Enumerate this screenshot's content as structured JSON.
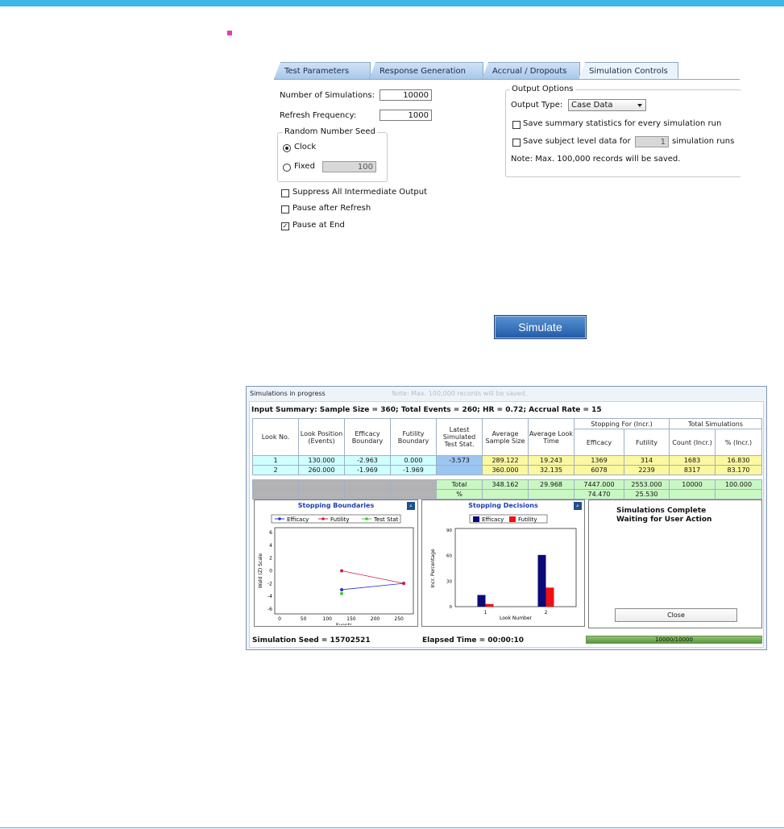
{
  "tabs": [
    "Test Parameters",
    "Response Generation",
    "Accrual / Dropouts",
    "Simulation Controls"
  ],
  "sim_controls": {
    "num_sims_label": "Number of Simulations:",
    "num_sims_value": "10000",
    "refresh_label": "Refresh Frequency:",
    "refresh_value": "1000",
    "seed_group": "Random Number Seed",
    "clock_label": "Clock",
    "fixed_label": "Fixed",
    "fixed_value": "100",
    "suppress_label": "Suppress All Intermediate Output",
    "pause_refresh_label": "Pause after Refresh",
    "pause_end_label": "Pause at End",
    "pause_end_check": "✓"
  },
  "output_options": {
    "group": "Output Options",
    "type_label": "Output Type:",
    "type_value": "Case Data",
    "save_summary": "Save summary statistics for every simulation run",
    "save_subject": "Save subject level data for",
    "subject_value": "1",
    "sim_runs": "simulation runs",
    "note": "Note: Max. 100,000 records will be saved."
  },
  "simulate_button": "Simulate",
  "window": {
    "title": "Simulations in progress",
    "ghost": "Note: Max. 100,000 records will be saved.",
    "summary": "Input Summary: Sample Size = 360; Total Events = 260; HR = 0.72; Accrual Rate = 15",
    "headers": {
      "look_no": "Look No.",
      "look_pos": "Look Position (Events)",
      "eff_bound": "Efficacy Boundary",
      "fut_bound": "Futility Boundary",
      "latest": "Latest Simulated Test Stat.",
      "avg_ss": "Average Sample Size",
      "avg_look": "Average Look Time",
      "stopping": "Stopping For (Incr.)",
      "efficacy": "Efficacy",
      "futility": "Futility",
      "total_sims": "Total Simulations",
      "count": "Count (Incr.)",
      "pct": "% (Incr.)"
    },
    "rows": [
      {
        "look": "1",
        "pos": "130.000",
        "eff": "-2.963",
        "fut": "0.000",
        "latest": "-3.573",
        "ss": "289.122",
        "time": "19.243",
        "s_eff": "1369",
        "s_fut": "314",
        "count": "1683",
        "pct": "16.830"
      },
      {
        "look": "2",
        "pos": "260.000",
        "eff": "-1.969",
        "fut": "-1.969",
        "latest": "",
        "ss": "360.000",
        "time": "32.135",
        "s_eff": "6078",
        "s_fut": "2239",
        "count": "8317",
        "pct": "83.170"
      }
    ],
    "total_row": {
      "label": "Total",
      "ss": "348.162",
      "time": "29.968",
      "s_eff": "7447.000",
      "s_fut": "2553.000",
      "count": "10000",
      "pct": "100.000"
    },
    "pct_row": {
      "label": "%",
      "s_eff": "74.470",
      "s_fut": "25.530"
    },
    "status_line1": "Simulations Complete",
    "status_line2": "Waiting for User Action",
    "close_label": "Close",
    "seed_text": "Simulation Seed = 15702521",
    "elapsed_text": "Elapsed Time = 00:00:10",
    "progress_text": "10000/10000",
    "progress_fraction": 1.0
  },
  "chart_data": [
    {
      "type": "line",
      "title": "Stopping Boundaries",
      "xlabel": "Events",
      "ylabel": "Wald (Z) Scale",
      "xlim": [
        0,
        270
      ],
      "ylim": [
        -6,
        6
      ],
      "xticks": [
        0,
        50,
        100,
        150,
        200,
        250
      ],
      "yticks": [
        6,
        4,
        2,
        0,
        -2,
        -4,
        -6
      ],
      "legend_position": "top",
      "series": [
        {
          "name": "Efficacy",
          "color": "#2233cc",
          "x": [
            130,
            260
          ],
          "y": [
            -2.963,
            -1.969
          ]
        },
        {
          "name": "Futility",
          "color": "#cc2244",
          "x": [
            130,
            260
          ],
          "y": [
            0.0,
            -1.969
          ]
        },
        {
          "name": "Test Stat",
          "color": "#33cc33",
          "x": [
            130
          ],
          "y": [
            -3.573
          ]
        }
      ]
    },
    {
      "type": "bar",
      "title": "Stopping Decisions",
      "xlabel": "Look Number",
      "ylabel": "Incr. Percentage",
      "categories": [
        "1",
        "2"
      ],
      "ylim": [
        0,
        90
      ],
      "yticks": [
        0,
        30,
        60,
        90
      ],
      "legend_position": "top",
      "series": [
        {
          "name": "Efficacy",
          "color": "#0a0a7a",
          "values": [
            13.69,
            60.78
          ]
        },
        {
          "name": "Futility",
          "color": "#ee1111",
          "values": [
            3.14,
            22.39
          ]
        }
      ]
    }
  ]
}
